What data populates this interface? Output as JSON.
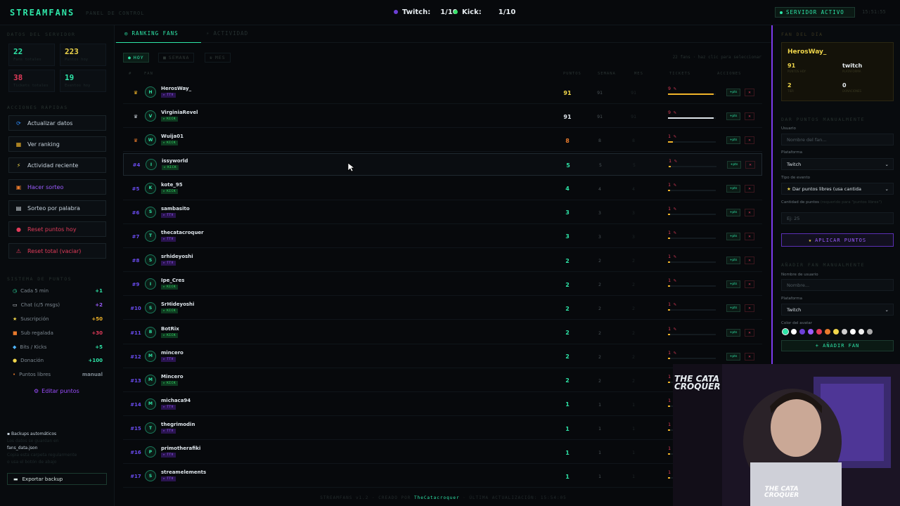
{
  "header": {
    "logo": "STREAMFANS",
    "subtitle": "PANEL DE CONTROL",
    "platforms": [
      {
        "name": "Twitch:",
        "count": "1/10",
        "color": "#6c3fd6"
      },
      {
        "name": "Kick:",
        "count": "1/10",
        "color": "#39e26a"
      }
    ],
    "server_status": "SERVIDOR ACTIVO",
    "clock": "15:51:55"
  },
  "sidebar": {
    "stats_title": "DATOS DEL SERVIDOR",
    "stats": [
      {
        "value": "22",
        "label": "Fans totales",
        "color": "#2ee6a8"
      },
      {
        "value": "223",
        "label": "Puntos hoy",
        "color": "#f0d64b"
      },
      {
        "value": "38",
        "label": "Tickets totales",
        "color": "#e23b5a"
      },
      {
        "value": "19",
        "label": "Eventos hoy",
        "color": "#2ee6a8"
      }
    ],
    "actions_title": "ACCIONES RÁPIDAS",
    "actions": [
      {
        "label": "Actualizar datos",
        "icon": "refresh-icon",
        "color": "#c6d2dc"
      },
      {
        "label": "Ver ranking",
        "icon": "ranking-icon",
        "color": "#c6d2dc"
      },
      {
        "label": "Actividad reciente",
        "icon": "activity-icon",
        "color": "#c6d2dc"
      },
      {
        "label": "Hacer sorteo",
        "icon": "raffle-icon",
        "color": "#9c5cff"
      },
      {
        "label": "Sorteo por palabra",
        "icon": "keyword-icon",
        "color": "#c6d2dc"
      },
      {
        "label": "Reset puntos hoy",
        "icon": "reset-icon",
        "color": "#e23b5a"
      },
      {
        "label": "Reset total (vaciar)",
        "icon": "warning-icon",
        "color": "#e23b5a"
      }
    ],
    "points_title": "SISTEMA DE PUNTOS",
    "points": [
      {
        "label": "Cada 5 min",
        "value": "+1",
        "color": "#2ee6a8",
        "icon": "clock-icon"
      },
      {
        "label": "Chat (c/5 msgs)",
        "value": "+2",
        "color": "#9c5cff",
        "icon": "chat-icon"
      },
      {
        "label": "Suscripción",
        "value": "+50",
        "color": "#f0b429",
        "icon": "star-icon"
      },
      {
        "label": "Sub regalada",
        "value": "+30",
        "color": "#e23b5a",
        "icon": "gift-icon"
      },
      {
        "label": "Bits / Kicks",
        "value": "+5",
        "color": "#2ee6a8",
        "icon": "diamond-icon"
      },
      {
        "label": "Donación",
        "value": "+100",
        "color": "#2ee6a8",
        "icon": "coin-icon"
      },
      {
        "label": "Puntos libres",
        "value": "manual",
        "color": "#7c8790",
        "icon": "dot-icon"
      }
    ],
    "edit_label": "Editar puntos",
    "backup_title": "Backups automáticos",
    "backup_line1": "Los datos se guardan en",
    "backup_file": "fans_data.json",
    "backup_line2": "Copia esta carpeta regularmente",
    "backup_line3": "o usa el botón de abajo",
    "export_label": "Exportar backup"
  },
  "tabs": [
    {
      "label": "RANKING FANS",
      "icon": "trophy-icon"
    },
    {
      "label": "ACTIVIDAD",
      "icon": "bolt-icon"
    }
  ],
  "filters": [
    {
      "label": "HOY"
    },
    {
      "label": "SEMANA"
    },
    {
      "label": "MES"
    }
  ],
  "filter_hint": "22 fans · haz clic para seleccionar",
  "columns": {
    "rank": "#",
    "fan": "FAN",
    "points": "PUNTOS",
    "week": "SEMANA",
    "month": "MES",
    "tickets": "TICKETS",
    "actions": "ACCIONES"
  },
  "fans": [
    {
      "rank": "♛",
      "initial": "H",
      "name": "HerosWay_",
      "platform": "TTV",
      "score": "91",
      "week": "91",
      "month": "91",
      "tickets": "9",
      "bar": 0.95,
      "score_color": "#f0d64b",
      "rank_color": "#f0b429"
    },
    {
      "rank": "♛",
      "initial": "V",
      "name": "VirginiaRevel",
      "platform": "KICK",
      "score": "91",
      "week": "91",
      "month": "91",
      "tickets": "9",
      "bar": 0.95,
      "score_color": "#dde4ea",
      "rank_color": "#c0c8d0"
    },
    {
      "rank": "♛",
      "initial": "W",
      "name": "Wuija01",
      "platform": "KICK",
      "score": "8",
      "week": "8",
      "month": "8",
      "tickets": "1",
      "bar": 0.1,
      "score_color": "#e87a2c",
      "rank_color": "#e87a2c"
    },
    {
      "rank": "#4",
      "initial": "I",
      "name": "issyworld",
      "platform": "KICK",
      "score": "5",
      "week": "5",
      "month": "5",
      "tickets": "1",
      "bar": 0.05,
      "score_color": "#2ee6a8",
      "rank_color": "#6a4cf0"
    },
    {
      "rank": "#5",
      "initial": "K",
      "name": "kote_95",
      "platform": "KICK",
      "score": "4",
      "week": "4",
      "month": "4",
      "tickets": "1",
      "bar": 0.04,
      "score_color": "#2ee6a8",
      "rank_color": "#6a4cf0"
    },
    {
      "rank": "#6",
      "initial": "S",
      "name": "sambasito",
      "platform": "TTV",
      "score": "3",
      "week": "3",
      "month": "3",
      "tickets": "1",
      "bar": 0.03,
      "score_color": "#2ee6a8",
      "rank_color": "#6a4cf0"
    },
    {
      "rank": "#7",
      "initial": "T",
      "name": "thecatacroquer",
      "platform": "TTV",
      "score": "3",
      "week": "3",
      "month": "3",
      "tickets": "1",
      "bar": 0.03,
      "score_color": "#2ee6a8",
      "rank_color": "#6a4cf0"
    },
    {
      "rank": "#8",
      "initial": "S",
      "name": "srhideyoshi",
      "platform": "TTV",
      "score": "2",
      "week": "2",
      "month": "2",
      "tickets": "1",
      "bar": 0.02,
      "score_color": "#2ee6a8",
      "rank_color": "#6a4cf0"
    },
    {
      "rank": "#9",
      "initial": "I",
      "name": "Ipe_Cres",
      "platform": "KICK",
      "score": "2",
      "week": "2",
      "month": "2",
      "tickets": "1",
      "bar": 0.02,
      "score_color": "#2ee6a8",
      "rank_color": "#6a4cf0"
    },
    {
      "rank": "#10",
      "initial": "S",
      "name": "SrHideyoshi",
      "platform": "KICK",
      "score": "2",
      "week": "2",
      "month": "2",
      "tickets": "1",
      "bar": 0.02,
      "score_color": "#2ee6a8",
      "rank_color": "#6a4cf0"
    },
    {
      "rank": "#11",
      "initial": "B",
      "name": "BotRix",
      "platform": "KICK",
      "score": "2",
      "week": "2",
      "month": "2",
      "tickets": "1",
      "bar": 0.02,
      "score_color": "#2ee6a8",
      "rank_color": "#6a4cf0"
    },
    {
      "rank": "#12",
      "initial": "M",
      "name": "mincero",
      "platform": "TTV",
      "score": "2",
      "week": "2",
      "month": "2",
      "tickets": "1",
      "bar": 0.02,
      "score_color": "#2ee6a8",
      "rank_color": "#6a4cf0"
    },
    {
      "rank": "#13",
      "initial": "M",
      "name": "Mincero",
      "platform": "KICK",
      "score": "2",
      "week": "2",
      "month": "2",
      "tickets": "1",
      "bar": 0.02,
      "score_color": "#2ee6a8",
      "rank_color": "#6a4cf0"
    },
    {
      "rank": "#14",
      "initial": "M",
      "name": "michaca94",
      "platform": "TTV",
      "score": "1",
      "week": "1",
      "month": "1",
      "tickets": "1",
      "bar": 0.01,
      "score_color": "#2ee6a8",
      "rank_color": "#6a4cf0"
    },
    {
      "rank": "#15",
      "initial": "T",
      "name": "thegrimodin",
      "platform": "TTV",
      "score": "1",
      "week": "1",
      "month": "1",
      "tickets": "1",
      "bar": 0.01,
      "score_color": "#2ee6a8",
      "rank_color": "#6a4cf0"
    },
    {
      "rank": "#16",
      "initial": "P",
      "name": "primotherafiki",
      "platform": "TTV",
      "score": "1",
      "week": "1",
      "month": "1",
      "tickets": "1",
      "bar": 0.01,
      "score_color": "#2ee6a8",
      "rank_color": "#6a4cf0"
    },
    {
      "rank": "#17",
      "initial": "S",
      "name": "streamelements",
      "platform": "TTV",
      "score": "1",
      "week": "1",
      "month": "1",
      "tickets": "1",
      "bar": 0.01,
      "score_color": "#2ee6a8",
      "rank_color": "#6a4cf0"
    }
  ],
  "row_actions": {
    "add": "+pts",
    "delete": "✕"
  },
  "footer": {
    "left": "STREAMFANS v1.2",
    "mid": "CREADO POR",
    "link": "TheCatacroquer",
    "right": "ÚLTIMA ACTUALIZACIÓN: 15:54:05"
  },
  "right_panel": {
    "title": "FAN DEL DÍA",
    "fan_name": "HerosWay_",
    "fan_stats": [
      {
        "value": "91",
        "label": "PUNTOS HOY",
        "white": false
      },
      {
        "value": "twitch",
        "label": "PLATAFORMA",
        "white": true
      },
      {
        "value": "2",
        "label": "TIER",
        "white": false
      },
      {
        "value": "0",
        "label": "DONACIONES",
        "white": true
      }
    ],
    "manual_title": "DAR PUNTOS MANUALMENTE",
    "user_label": "Usuario",
    "user_placeholder": "Nombre del fan...",
    "platform_label": "Plataforma",
    "platform_value": "Twitch",
    "event_label": "Tipo de evento",
    "event_value": "Dar puntos libres (usa cantida",
    "amount_label": "Cantidad de puntos",
    "amount_note": "(requerido para \"puntos libres\")",
    "amount_placeholder": "Ej: 25",
    "apply_label": "APLICAR PUNTOS",
    "add_title": "AÑADIR FAN MANUALMENTE",
    "username_label": "Nombre de usuario",
    "name_placeholder": "Nombre...",
    "platform2_label": "Plataforma",
    "platform2_value": "Twitch",
    "color_label": "Color del avatar",
    "swatches": [
      "#2ee6a8",
      "#ffffff",
      "#6c3fd6",
      "#9c5cff",
      "#e23b5a",
      "#e87a2c",
      "#f0d64b",
      "#d0d0d0",
      "#ffffff",
      "#f0f0f0",
      "#aaaaaa"
    ],
    "add_button": "+ AÑADIR FAN"
  },
  "webcam": {
    "logo_line1": "THE CATA",
    "logo_line2": "CROQUER"
  }
}
